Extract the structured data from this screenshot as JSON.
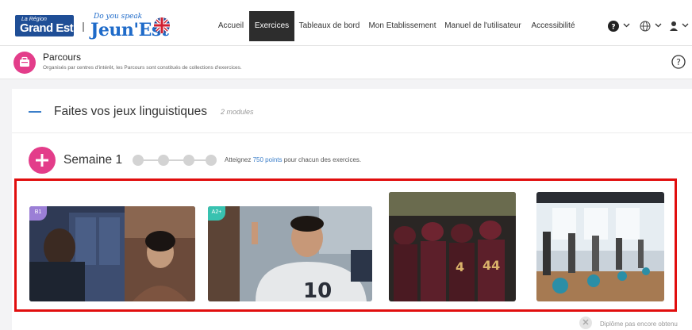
{
  "header": {
    "logo_region_small": "La Région",
    "logo_region_big": "Grand Est",
    "logo_jeun_small": "Do you speak",
    "logo_jeun_big": "Jeun'Est",
    "nav": [
      "Accueil",
      "Exercices",
      "Tableaux de bord",
      "Mon Etablissement",
      "Manuel de l'utilisateur",
      "Accessibilité"
    ],
    "active_nav": "Exercices",
    "icons": [
      "help-icon",
      "globe-icon",
      "user-icon"
    ]
  },
  "parcours": {
    "title": "Parcours",
    "subtitle": "Organisés par centres d'intérêt, les Parcours sont constitués de collections d'exercices."
  },
  "module": {
    "title": "Faites vos jeux linguistiques",
    "count": "2 modules"
  },
  "week": {
    "title": "Semaine 1",
    "goal_prefix": "Atteignez",
    "goal_points": "750 points",
    "goal_suffix": "pour chacun des exercices."
  },
  "exercises": [
    {
      "level": "B1",
      "badge_color": "#9b7fd6",
      "scene": "two-people-lockers"
    },
    {
      "level": "A2+",
      "badge_color": "#38c2b0",
      "scene": "football-coach"
    },
    {
      "level": "",
      "badge_color": "",
      "scene": "football-team"
    },
    {
      "level": "",
      "badge_color": "",
      "scene": "gym-class"
    }
  ],
  "footer": {
    "diploma_status": "Diplôme pas encore obtenu"
  },
  "colors": {
    "accent_pink": "#e33d8a",
    "accent_blue": "#3b7ec9",
    "nav_active": "#2d2d2d",
    "highlight_frame": "#e10e0e"
  }
}
